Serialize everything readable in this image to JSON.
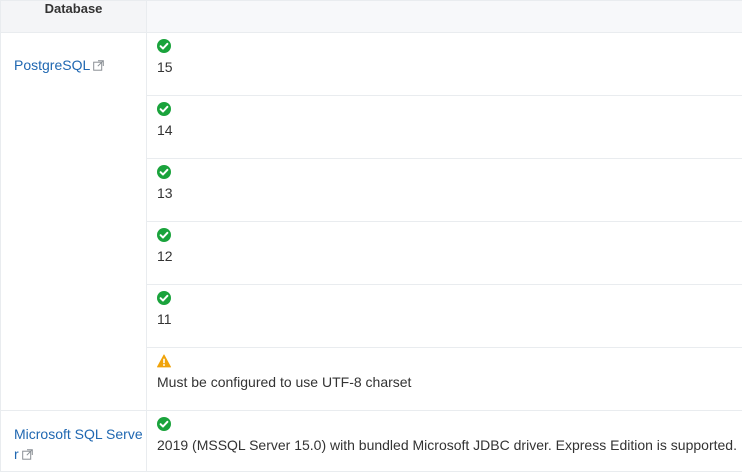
{
  "table": {
    "header": {
      "database": "Database",
      "versions": ""
    },
    "rows": [
      {
        "database": "PostgreSQL",
        "status": "supported",
        "status_icon": "check-circle-icon",
        "text": "15"
      },
      {
        "database": "",
        "status": "supported",
        "status_icon": "check-circle-icon",
        "text": "14"
      },
      {
        "database": "",
        "status": "supported",
        "status_icon": "check-circle-icon",
        "text": "13"
      },
      {
        "database": "",
        "status": "supported",
        "status_icon": "check-circle-icon",
        "text": "12"
      },
      {
        "database": "",
        "status": "supported",
        "status_icon": "check-circle-icon",
        "text": "11"
      },
      {
        "database": "",
        "status": "warning",
        "status_icon": "warning-triangle-icon",
        "text": "Must be configured to use UTF-8 charset"
      },
      {
        "database": "Microsoft SQL Server",
        "status": "supported",
        "status_icon": "check-circle-icon",
        "text": "2019 (MSSQL Server 15.0) with bundled Microsoft JDBC driver. Express Edition is supported."
      }
    ]
  },
  "colors": {
    "link": "#1f67b1",
    "supported": "#1aa33c",
    "warning": "#f0a30a",
    "header_bg": "#f4f5f7",
    "border": "#e9ecef"
  }
}
